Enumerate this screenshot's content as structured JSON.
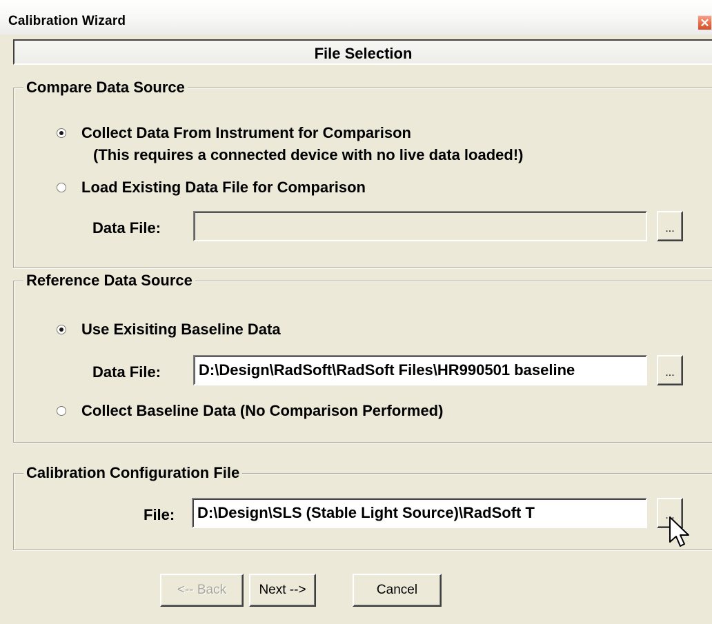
{
  "window": {
    "title": "Calibration Wizard",
    "close_glyph": "✕"
  },
  "banner": {
    "title": "File Selection"
  },
  "compare_group": {
    "label": "Compare Data Source",
    "option_instrument": {
      "label": "Collect Data From Instrument for Comparison",
      "note": "(This requires a connected device with no live data loaded!)",
      "checked": true
    },
    "option_existing": {
      "label": "Load Existing Data File for Comparison",
      "checked": false
    },
    "data_file_label": "Data File:",
    "data_file_value": "",
    "browse_label": "..."
  },
  "reference_group": {
    "label": "Reference Data Source",
    "option_baseline": {
      "label": "Use Exisiting Baseline Data",
      "checked": true
    },
    "data_file_label": "Data File:",
    "data_file_value": "D:\\Design\\RadSoft\\RadSoft Files\\HR990501 baseline",
    "browse_label": "...",
    "option_collect": {
      "label": "Collect Baseline Data (No Comparison Performed)",
      "checked": false
    }
  },
  "config_group": {
    "label": "Calibration Configuration File",
    "file_label": "File:",
    "file_value": "D:\\Design\\SLS (Stable Light Source)\\RadSoft T",
    "browse_label": "..."
  },
  "buttons": {
    "back": "<-- Back",
    "next": "Next -->",
    "cancel": "Cancel"
  },
  "colors": {
    "dialog_bg": "#ece9d8",
    "close_button": "#e76842"
  },
  "icons": {
    "close": "close-icon",
    "radio_checked": "radio-checked-icon",
    "radio_unchecked": "radio-unchecked-icon",
    "cursor": "mouse-pointer-icon"
  }
}
